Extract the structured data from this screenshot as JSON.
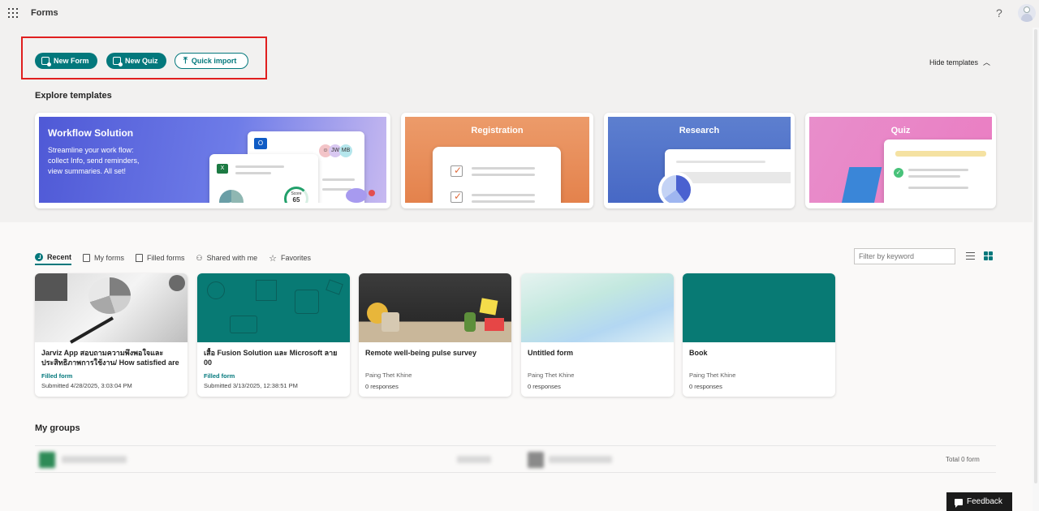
{
  "app": {
    "title": "Forms"
  },
  "actions": {
    "new_form": "New Form",
    "new_quiz": "New Quiz",
    "quick_import": "Quick import",
    "hide_templates": "Hide templates"
  },
  "templates": {
    "heading": "Explore templates",
    "workflow": {
      "title": "Workflow Solution",
      "desc": "Streamline your work flow: collect Info, send reminders, view summaries. All set!",
      "avatar_1": "JW",
      "avatar_2": "MB",
      "score_label": "Score",
      "score_value": "65"
    },
    "registration": {
      "title": "Registration"
    },
    "research": {
      "title": "Research"
    },
    "quiz": {
      "title": "Quiz"
    }
  },
  "tabs": [
    {
      "label": "Recent"
    },
    {
      "label": "My forms"
    },
    {
      "label": "Filled forms"
    },
    {
      "label": "Shared with me"
    },
    {
      "label": "Favorites"
    }
  ],
  "filter": {
    "placeholder": "Filter by keyword"
  },
  "cards": [
    {
      "title": "Jarviz App สอบถามความพึงพอใจและประสิทธิภาพการใช้งาน/ How satisfied are",
      "kind": "Filled form",
      "submitted": "Submitted 4/28/2025, 3:03:04 PM"
    },
    {
      "title": "เสื้อ Fusion Solution และ Microsoft ลาย 00",
      "kind": "Filled form",
      "submitted": "Submitted 3/13/2025, 12:38:51 PM"
    },
    {
      "title": "Remote well-being pulse survey",
      "owner": "Paing Thet Khine",
      "responses": "0 responses"
    },
    {
      "title": "Untitled form",
      "owner": "Paing Thet Khine",
      "responses": "0 responses"
    },
    {
      "title": "Book",
      "owner": "Paing Thet Khine",
      "responses": "0 responses"
    }
  ],
  "groups": {
    "heading": "My groups",
    "total": "Total 0 form"
  },
  "feedback": {
    "label": "Feedback"
  },
  "colors": {
    "accent": "#03787c",
    "highlight": "#e01f1f"
  }
}
